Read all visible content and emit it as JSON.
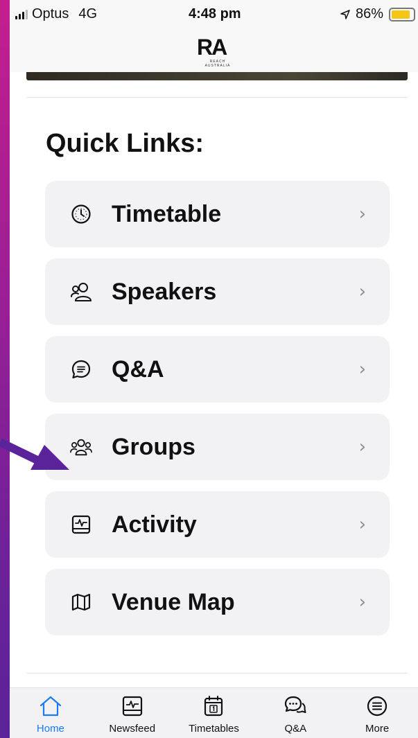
{
  "status_bar": {
    "carrier": "Optus",
    "network": "4G",
    "time": "4:48 pm",
    "battery": "86%",
    "battery_level": 0.86
  },
  "header": {
    "logo_text": "RA",
    "logo_sub": "REACH AUSTRALIA"
  },
  "quick_links": {
    "title": "Quick Links:",
    "items": [
      {
        "label": "Timetable",
        "icon": "clock-icon"
      },
      {
        "label": "Speakers",
        "icon": "people-icon"
      },
      {
        "label": "Q&A",
        "icon": "chat-bubble-icon"
      },
      {
        "label": "Groups",
        "icon": "group-icon"
      },
      {
        "label": "Activity",
        "icon": "activity-icon"
      },
      {
        "label": "Venue Map",
        "icon": "map-icon"
      }
    ],
    "chevron": "›"
  },
  "tab_bar": {
    "tabs": [
      {
        "label": "Home",
        "icon": "home-icon",
        "active": true
      },
      {
        "label": "Newsfeed",
        "icon": "activity-icon"
      },
      {
        "label": "Timetables",
        "icon": "calendar-icon"
      },
      {
        "label": "Q&A",
        "icon": "chat-bubbles-icon"
      },
      {
        "label": "More",
        "icon": "menu-icon"
      }
    ]
  },
  "colors": {
    "accent": "#1a7bf2",
    "card_background": "#f2f2f5",
    "annotation_arrow": "#5b2399"
  }
}
